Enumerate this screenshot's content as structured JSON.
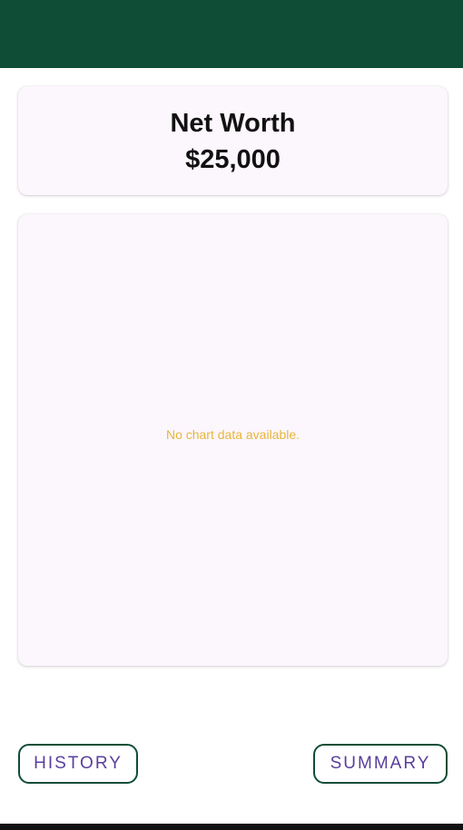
{
  "net_worth": {
    "title": "Net Worth",
    "value": "$25,000"
  },
  "chart": {
    "empty_message": "No chart data available."
  },
  "buttons": {
    "history_label": "HISTORY",
    "summary_label": "SUMMARY"
  },
  "colors": {
    "app_bar": "#0f4d36",
    "card_background": "#fcf6fd",
    "empty_message": "#e7b63a",
    "button_text": "#5a3e9c",
    "button_border": "#0f4d36"
  }
}
